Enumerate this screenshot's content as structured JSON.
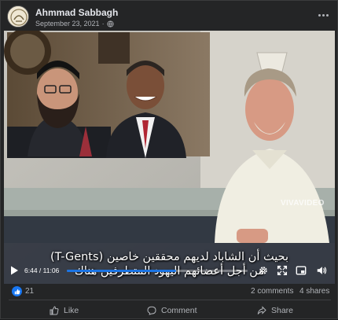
{
  "post": {
    "author": "Ahmmad Sabbagh",
    "date": "September 23, 2021",
    "separator": "·",
    "privacy_icon": "globe-icon",
    "more_icon": "more-options-icon"
  },
  "video": {
    "caption_line1": "بحيث أن الشاباد لديهم محققين خاصين (T-Gents)",
    "caption_line2": "من أجل أعضائهم اليهود المتطرفين هناك",
    "watermark": "VIVAVIDEO",
    "current_time": "6:44",
    "duration": "11:06",
    "time_separator": " / ",
    "progress_fraction": 0.606,
    "progress_color": "#1b74e4"
  },
  "stats": {
    "like_count": "21",
    "comments": "2 comments",
    "shares": "4 shares"
  },
  "actions": {
    "like_label": "Like",
    "comment_label": "Comment",
    "share_label": "Share"
  },
  "colors": {
    "card_bg": "#242526",
    "page_bg": "#18191a",
    "accent": "#1877f2",
    "text_primary": "#e4e6eb",
    "text_secondary": "#b0b3b8"
  }
}
